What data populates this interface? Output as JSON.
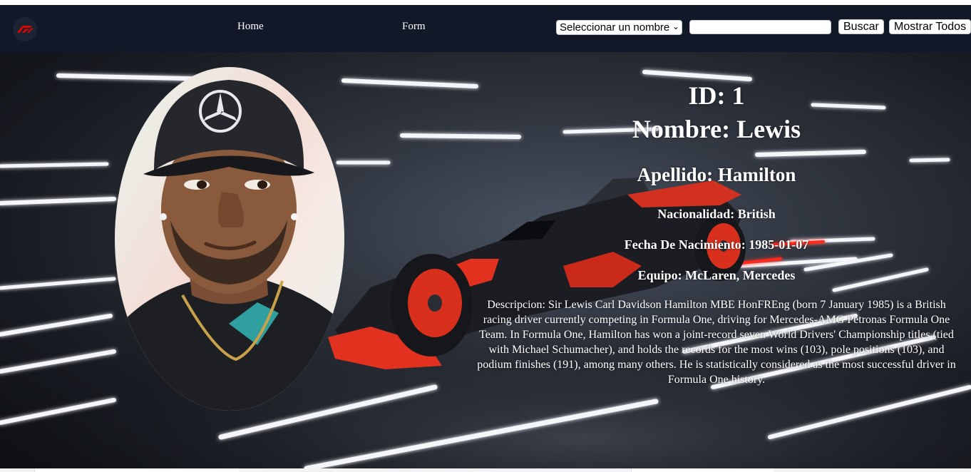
{
  "nav": {
    "logo": "f1-logo-icon",
    "home_label": "Home",
    "form_label": "Form",
    "select_value": "Seleccionar un nombre",
    "search_value": "",
    "search_button": "Buscar",
    "show_all_button": "Mostrar Todos"
  },
  "driver": {
    "id_line": "ID: 1",
    "nombre_line": "Nombre: Lewis",
    "apellido_line": "Apellido: Hamilton",
    "nacionalidad_line": "Nacionalidad: British",
    "fecha_line": "Fecha De Nacimiento: 1985-01-07",
    "equipo_line": "Equipo: McLaren, Mercedes",
    "descripcion_line": "Descripcion: Sir Lewis Carl Davidson Hamilton MBE HonFREng (born 7 January 1985) is a British racing driver currently competing in Formula One, driving for Mercedes-AMG Petronas Formula One Team. In Formula One, Hamilton has won a joint-record seven World Drivers' Championship titles (tied with Michael Schumacher), and holds the records for the most wins (103), pole positions (103), and podium finishes (191), among many others. He is statistically considered as the most successful driver in Formula One history."
  },
  "images": {
    "portrait": "driver-portrait",
    "background": "f1-car-background"
  },
  "colors": {
    "navbar": "#111827",
    "accent_red": "#e10600",
    "text": "#ffffff"
  }
}
